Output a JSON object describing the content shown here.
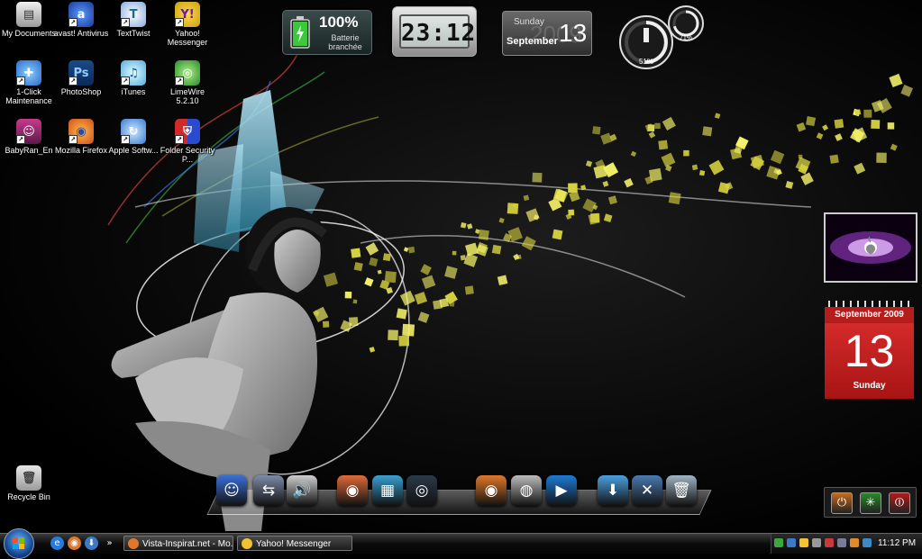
{
  "desktop_icons": [
    {
      "label": "My Documents",
      "icon": "my-documents-icon"
    },
    {
      "label": "avast! Antivirus",
      "icon": "avast-icon"
    },
    {
      "label": "TextTwist",
      "icon": "texttwist-icon"
    },
    {
      "label": "Yahoo! Messenger",
      "icon": "yahoo-messenger-icon"
    },
    {
      "label": "1-Click Maintenance",
      "icon": "maintenance-icon"
    },
    {
      "label": "PhotoShop",
      "icon": "photoshop-icon"
    },
    {
      "label": "iTunes",
      "icon": "itunes-icon"
    },
    {
      "label": "LimeWire 5.2.10",
      "icon": "limewire-icon"
    },
    {
      "label": "BabyRan_En",
      "icon": "babyran-icon"
    },
    {
      "label": "Mozilla Firefox",
      "icon": "firefox-icon"
    },
    {
      "label": "Apple Softw...",
      "icon": "apple-software-update-icon"
    },
    {
      "label": "Folder Security P...",
      "icon": "folder-security-icon"
    },
    {
      "label": "Recycle Bin",
      "icon": "recycle-bin-icon"
    }
  ],
  "gadgets": {
    "battery": {
      "percent": "100%",
      "status_line1": "Batterie",
      "status_line2": "branchée",
      "level": 1.0
    },
    "clock": {
      "time": "23:12"
    },
    "date": {
      "weekday": "Sunday",
      "month": "September",
      "day": "13",
      "watermark_year": "2009"
    },
    "meters": {
      "cpu": "51%",
      "ram": "71%",
      "cpu_level": 0.51,
      "ram_level": 0.71
    },
    "calendar": {
      "month_year": "September 2009",
      "day": "13",
      "weekday": "Sunday"
    }
  },
  "dock_items": [
    {
      "icon": "finder-icon",
      "color": "#3a6fd8"
    },
    {
      "icon": "network-icon",
      "color": "#7c8ca8"
    },
    {
      "icon": "speaker-icon",
      "color": "#cfcfcf"
    },
    {
      "icon": "media-player-icon",
      "color": "#e06a3a"
    },
    {
      "icon": "photo-viewer-icon",
      "color": "#3aa0d0"
    },
    {
      "icon": "camera-icon",
      "color": "#2a3a4a"
    },
    {
      "icon": "firefox-icon",
      "color": "#e0772a"
    },
    {
      "icon": "webcam-icon",
      "color": "#bdbdbd"
    },
    {
      "icon": "play-icon",
      "color": "#1e7ad6"
    },
    {
      "icon": "download-icon",
      "color": "#4aa0e0"
    },
    {
      "icon": "tools-icon",
      "color": "#4a7ab0"
    },
    {
      "icon": "trash-icon",
      "color": "#9fb4c4"
    }
  ],
  "shutdown_gadget": [
    {
      "icon": "power-icon",
      "color": "#c86a1a"
    },
    {
      "icon": "sleep-icon",
      "color": "#2a8a2a"
    },
    {
      "icon": "restart-icon",
      "color": "#b01a1a"
    }
  ],
  "taskbar": {
    "quick_launch": [
      {
        "icon": "ie-icon",
        "color": "#2a7ad6"
      },
      {
        "icon": "firefox-icon",
        "color": "#e0772a"
      },
      {
        "icon": "download-icon",
        "color": "#3a7ac8"
      }
    ],
    "overflow_glyph": "»",
    "windows": [
      {
        "label": "Vista-Inspirat.net - Mo...",
        "icon": "firefox-icon",
        "color": "#e0772a"
      },
      {
        "label": "Yahoo! Messenger",
        "icon": "yahoo-messenger-icon",
        "color": "#f2c230"
      }
    ],
    "clock": "11:12 PM",
    "tray_icons": [
      {
        "icon": "limewire-tray-icon",
        "color": "#3aa83a"
      },
      {
        "icon": "network-tray-icon",
        "color": "#3a7ac8"
      },
      {
        "icon": "yahoo-tray-icon",
        "color": "#f2c230"
      },
      {
        "icon": "volume-tray-icon",
        "color": "#999999"
      },
      {
        "icon": "security-tray-icon",
        "color": "#c83a3a"
      },
      {
        "icon": "display-tray-icon",
        "color": "#7a7a9a"
      },
      {
        "icon": "avast-tray-icon",
        "color": "#e08a2a"
      },
      {
        "icon": "update-tray-icon",
        "color": "#3a8ac8"
      }
    ]
  }
}
